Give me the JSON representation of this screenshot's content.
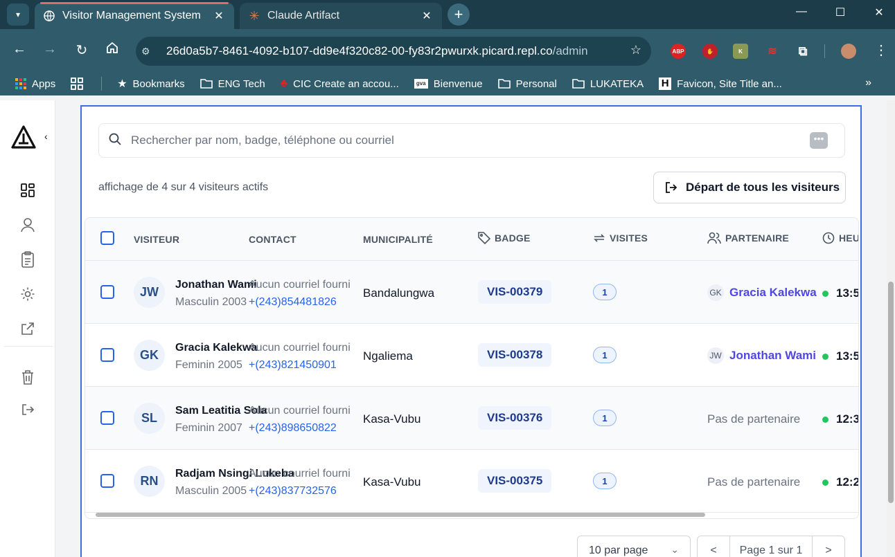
{
  "browser": {
    "tabs": [
      {
        "title": "Visitor Management System",
        "active": true
      },
      {
        "title": "Claude Artifact",
        "active": false
      }
    ],
    "url_host": "26d0a5b7-8461-4092-b107-dd9e4f320c82-00-fy83r2pwurxk.picard.repl.co",
    "url_path": "/admin",
    "extensions": [
      "ABP"
    ],
    "bookmarks": [
      {
        "label": "Apps",
        "icon": "apps-grid-icon"
      },
      {
        "label": "",
        "icon": "tab-grid-icon"
      },
      {
        "label": "Bookmarks",
        "icon": "star-icon"
      },
      {
        "label": "ENG Tech",
        "icon": "folder-icon"
      },
      {
        "label": "CIC Create an accou...",
        "icon": "maple-leaf-icon"
      },
      {
        "label": "Bienvenue",
        "icon": "gva-logo-icon"
      },
      {
        "label": "Personal",
        "icon": "folder-icon"
      },
      {
        "label": "LUKATEKA",
        "icon": "folder-icon"
      },
      {
        "label": "Favicon, Site Title an...",
        "icon": "h-logo-icon"
      }
    ],
    "bookmarks_more": "»"
  },
  "toolbar": {
    "search_placeholder": "Rechercher par nom, badge, téléphone ou courriel",
    "search_value": "",
    "count_text": "affichage de 4 sur 4 visiteurs actifs",
    "checkout_all_label": "Départ de tous les visiteurs"
  },
  "table": {
    "columns": [
      {
        "label": "VISITEUR"
      },
      {
        "label": "CONTACT"
      },
      {
        "label": "MUNICIPALITÉ"
      },
      {
        "label": "BADGE",
        "icon": "tag-icon"
      },
      {
        "label": "VISITES",
        "icon": "repeat-icon"
      },
      {
        "label": "PARTENAIRE",
        "icon": "users-icon"
      },
      {
        "label": "HEU",
        "icon": "clock-icon"
      }
    ],
    "rows": [
      {
        "initials": "JW",
        "name": "Jonathan Wami",
        "meta": "Masculin 2003",
        "email": "Aucun courriel fourni",
        "phone": "+(243)854481826",
        "municipality": "Bandalungwa",
        "badge": "VIS-00379",
        "visits": "1",
        "partner_initials": "GK",
        "partner": "Gracia Kalekwa",
        "time": "13:5"
      },
      {
        "initials": "GK",
        "name": "Gracia Kalekwa",
        "meta": "Feminin 2005",
        "email": "Aucun courriel fourni",
        "phone": "+(243)821450901",
        "municipality": "Ngaliema",
        "badge": "VIS-00378",
        "visits": "1",
        "partner_initials": "JW",
        "partner": "Jonathan Wami",
        "time": "13:5"
      },
      {
        "initials": "SL",
        "name": "Sam Leatitia Sola",
        "meta": "Feminin 2007",
        "email": "Aucun courriel fourni",
        "phone": "+(243)898650822",
        "municipality": "Kasa-Vubu",
        "badge": "VIS-00376",
        "visits": "1",
        "partner_initials": "",
        "partner": "Pas de partenaire",
        "time": "12:3"
      },
      {
        "initials": "RN",
        "name": "Radjam Nsingi Lukeba",
        "meta": "Masculin 2005",
        "email": "Aucun courriel fourni",
        "phone": "+(243)837732576",
        "municipality": "Kasa-Vubu",
        "badge": "VIS-00375",
        "visits": "1",
        "partner_initials": "",
        "partner": "Pas de partenaire",
        "time": "12:2"
      }
    ]
  },
  "pagination": {
    "per_page": "10 par page",
    "prev": "<",
    "page_label": "Page 1 sur 1",
    "next": ">"
  },
  "colors": {
    "accent": "#2563eb",
    "partner": "#4f46e5",
    "status_online": "#22c55e",
    "chrome": "#2f5b6b"
  }
}
